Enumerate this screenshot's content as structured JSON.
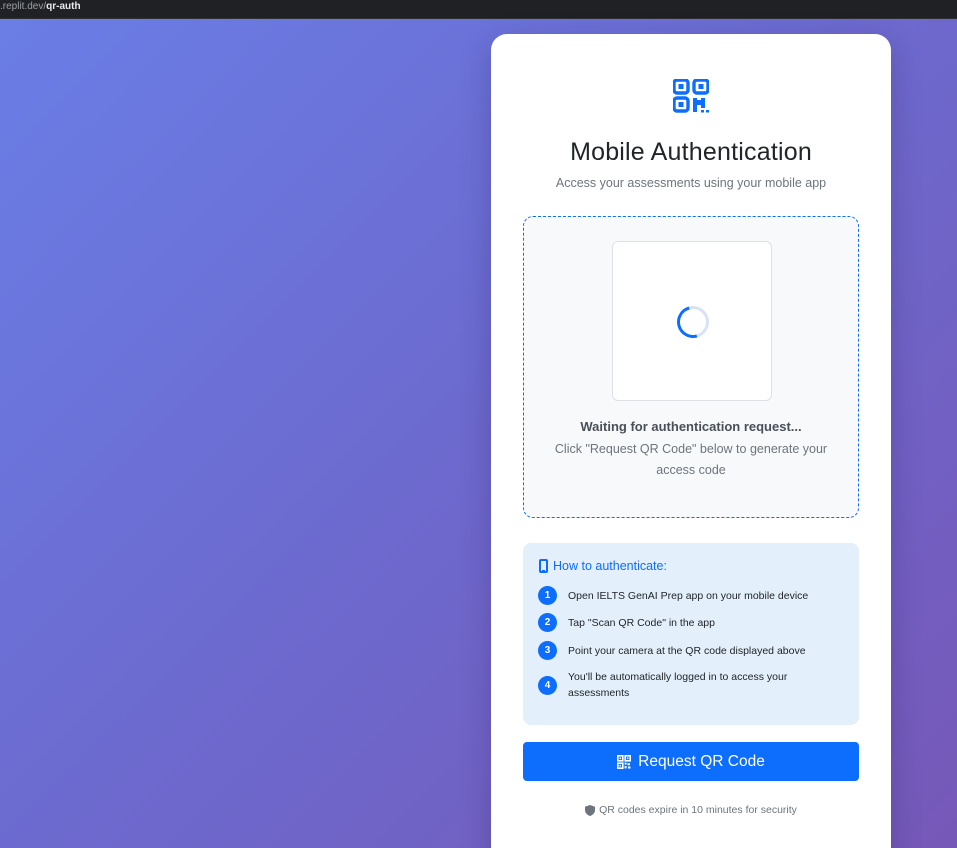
{
  "browser": {
    "url_host": ".replit.dev/",
    "url_path": "qr-auth"
  },
  "card": {
    "title": "Mobile Authentication",
    "subtitle": "Access your assessments using your mobile app"
  },
  "qr_area": {
    "status_title": "Waiting for authentication request...",
    "status_desc": "Click \"Request QR Code\" below to generate your access code"
  },
  "howto": {
    "title": "How to authenticate:",
    "steps": [
      {
        "num": "1",
        "text": "Open IELTS GenAI Prep app on your mobile device"
      },
      {
        "num": "2",
        "text": "Tap \"Scan QR Code\" in the app"
      },
      {
        "num": "3",
        "text": "Point your camera at the QR code displayed above"
      },
      {
        "num": "4",
        "text": "You'll be automatically logged in to access your assessments"
      }
    ]
  },
  "actions": {
    "request_label": "Request QR Code"
  },
  "footer_note": "QR codes expire in 10 minutes for security",
  "colors": {
    "primary": "#0d6efd",
    "bg_gradient_start": "#6a7ee6",
    "bg_gradient_end": "#7658b8"
  },
  "icons": {
    "logo": "qrcode-icon",
    "howto": "phone-icon",
    "button": "qrcode-icon",
    "note": "shield-icon"
  }
}
